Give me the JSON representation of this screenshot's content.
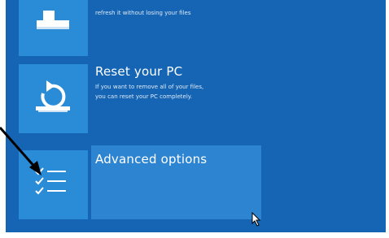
{
  "options": [
    {
      "id": "refresh",
      "icon": "refresh-pc-icon",
      "description_line_2": "refresh it without losing your files"
    },
    {
      "id": "reset",
      "icon": "reset-pc-icon",
      "title": "Reset your PC",
      "description_line_1": "If you want to remove all of your files,",
      "description_line_2": "you can reset your PC completely."
    },
    {
      "id": "advanced",
      "icon": "checklist-icon",
      "title": "Advanced options"
    }
  ],
  "colors": {
    "background": "#1565b4",
    "tile": "#2a8bd6",
    "highlight": "#2d84d0",
    "text": "#ffffff"
  }
}
